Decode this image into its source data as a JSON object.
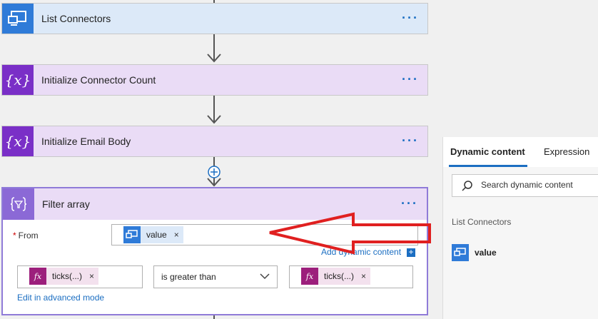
{
  "cards": [
    {
      "title": "List Connectors",
      "icon": "power-apps-icon",
      "color": "#2f7bd8"
    },
    {
      "title": "Initialize Connector Count",
      "icon": "variable-icon",
      "color": "#7a2fc7"
    },
    {
      "title": "Initialize Email Body",
      "icon": "variable-icon",
      "color": "#7a2fc7"
    }
  ],
  "variable_glyph": "{x}",
  "more_glyph": "···",
  "filter": {
    "title": "Filter array",
    "from_label": "From",
    "required_mark": "*",
    "from_token": "value",
    "token_remove": "×",
    "add_dynamic_content": "Add dynamic content",
    "add_plus": "+",
    "left_token": "ticks(...)",
    "operator": "is greater than",
    "right_token": "ticks(...)",
    "fx_glyph": "fx",
    "edit_advanced": "Edit in advanced mode"
  },
  "panel": {
    "tabs": [
      "Dynamic content",
      "Expression"
    ],
    "active_tab": "Dynamic content",
    "search_placeholder": "Search dynamic content",
    "section": "List Connectors",
    "items": [
      "value"
    ]
  },
  "colors": {
    "accent": "#1b6ec2",
    "annotation_arrow": "#e02020",
    "variable_purple": "#7a2fc7",
    "filter_purple": "#8b69d6",
    "connector_blue": "#2f7bd8"
  }
}
